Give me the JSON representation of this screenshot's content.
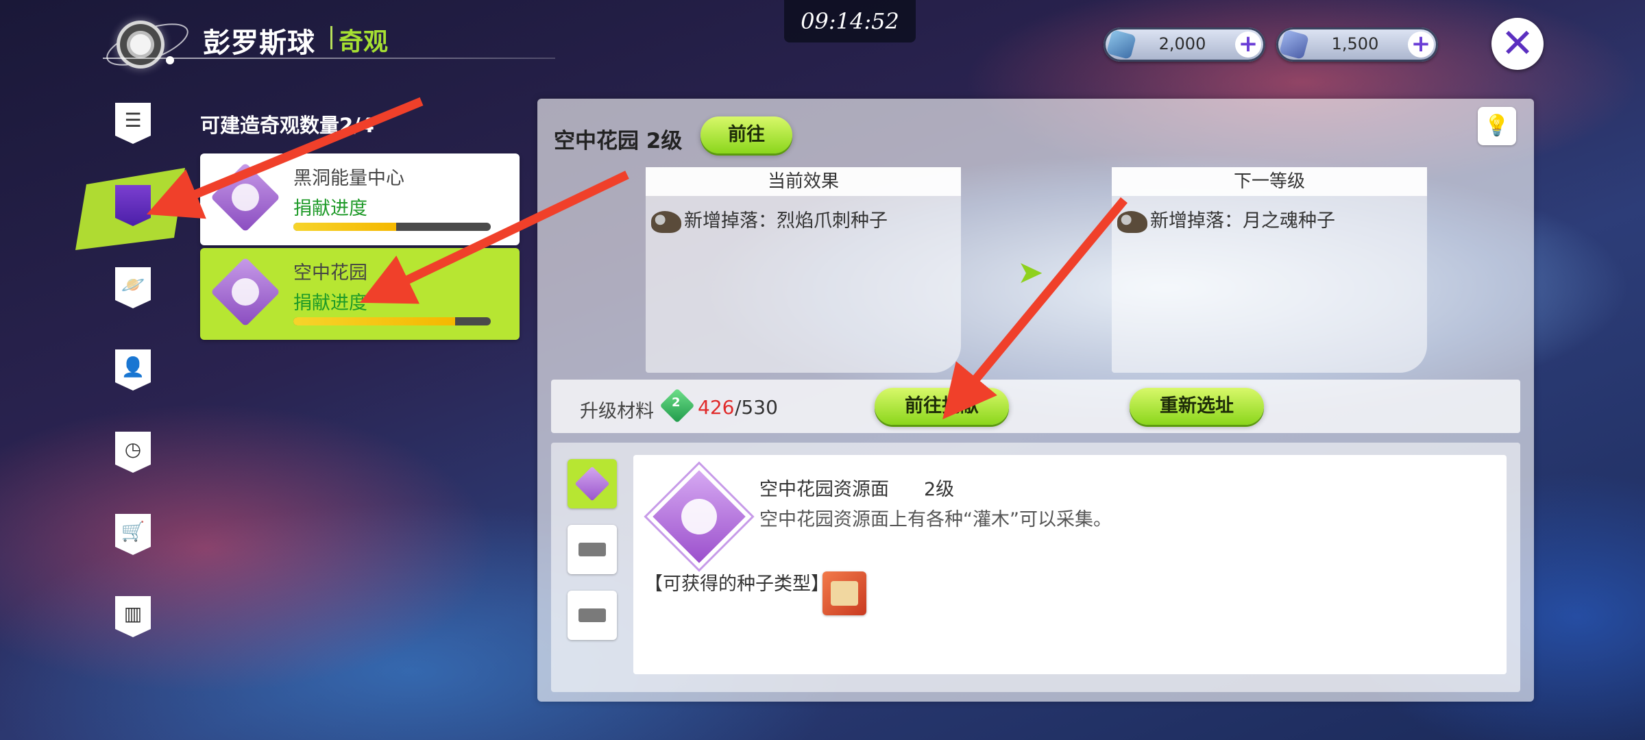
{
  "header": {
    "title": "彭罗斯球",
    "subtitle": "奇观",
    "time": "09:14:52",
    "currency": [
      {
        "icon": "crystal-icon",
        "value": "2,000",
        "plus": "+"
      },
      {
        "icon": "star-crystal-icon",
        "value": "1,500",
        "plus": "+"
      }
    ],
    "close_label": "✕"
  },
  "sidebar": {
    "icons": [
      "list-icon",
      "wonder-icon",
      "planet-icon",
      "person-icon",
      "clock-icon",
      "cart-icon",
      "chart-icon"
    ],
    "active_index": 1
  },
  "wonders": {
    "count_label": "可建造奇观数量2/4",
    "cards": [
      {
        "name": "黑洞能量中心",
        "progress_label": "捐献进度",
        "progress": 0.52,
        "selected": false
      },
      {
        "name": "空中花园",
        "progress_label": "捐献进度",
        "progress": 0.82,
        "selected": true
      }
    ]
  },
  "panel": {
    "title": "空中花园 2级",
    "goto_label": "前往",
    "hint_icon": "lightbulb-icon",
    "current_effect": {
      "header": "当前效果",
      "text": "新增掉落：烈焰爪刺种子"
    },
    "next_level": {
      "header": "下一等级",
      "text": "新增掉落：月之魂种子"
    },
    "materials": {
      "label": "升级材料",
      "badge": "2",
      "have": "426",
      "need": "/530"
    },
    "donate_label": "前往捐献",
    "relocate_label": "重新选址",
    "detail": {
      "name": "空中花园资源面",
      "level": "2级",
      "description": "空中花园资源面上有各种“灌木”可以采集。",
      "seed_label": "【可获得的种子类型】"
    }
  },
  "colors": {
    "accent_green": "#b7e632",
    "progress_yellow": "#f6d42b",
    "have_red": "#e02a2a",
    "arrow_red": "#f0402a"
  }
}
